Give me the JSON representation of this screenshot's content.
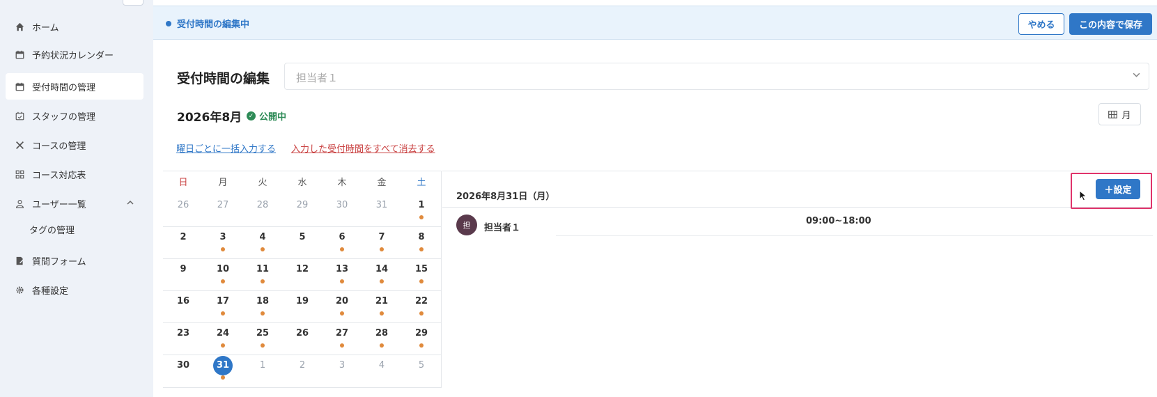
{
  "sidebar": {
    "items": [
      {
        "label": "ホーム",
        "icon": "home-icon"
      },
      {
        "label": "予約状況カレンダー",
        "icon": "calendar-icon"
      },
      {
        "label": "受付時間の管理",
        "icon": "calendar-edit-icon",
        "active": true
      },
      {
        "label": "スタッフの管理",
        "icon": "calendar-check-icon"
      },
      {
        "label": "コースの管理",
        "icon": "tools-icon"
      },
      {
        "label": "コース対応表",
        "icon": "grid-icon"
      },
      {
        "label": "ユーザー一覧",
        "icon": "user-icon",
        "expanded": true
      },
      {
        "label": "質問フォーム",
        "icon": "form-edit-icon"
      },
      {
        "label": "各種設定",
        "icon": "gear-icon"
      }
    ],
    "sub_items": [
      {
        "label": "タグの管理"
      }
    ]
  },
  "banner": {
    "status": "受付時間の編集中",
    "cancel_label": "やめる",
    "save_label": "この内容で保存"
  },
  "editor": {
    "title": "受付時間の編集",
    "staff_select_value": "担当者１",
    "month_title": "2026年8月",
    "publish_status": "公開中",
    "view_label": "月",
    "bulk_link": "曜日ごとに一括入力する",
    "clear_link": "入力した受付時間をすべて消去する"
  },
  "calendar": {
    "weekdays": [
      "日",
      "月",
      "火",
      "水",
      "木",
      "金",
      "土"
    ],
    "weeks": [
      [
        {
          "d": "26",
          "o": true
        },
        {
          "d": "27",
          "o": true
        },
        {
          "d": "28",
          "o": true
        },
        {
          "d": "29",
          "o": true
        },
        {
          "d": "30",
          "o": true
        },
        {
          "d": "31",
          "o": true
        },
        {
          "d": "1",
          "dot": true
        }
      ],
      [
        {
          "d": "2"
        },
        {
          "d": "3",
          "dot": true
        },
        {
          "d": "4",
          "dot": true
        },
        {
          "d": "5"
        },
        {
          "d": "6",
          "dot": true
        },
        {
          "d": "7",
          "dot": true
        },
        {
          "d": "8",
          "dot": true
        }
      ],
      [
        {
          "d": "9"
        },
        {
          "d": "10",
          "dot": true
        },
        {
          "d": "11",
          "dot": true
        },
        {
          "d": "12"
        },
        {
          "d": "13",
          "dot": true
        },
        {
          "d": "14",
          "dot": true
        },
        {
          "d": "15",
          "dot": true
        }
      ],
      [
        {
          "d": "16"
        },
        {
          "d": "17",
          "dot": true
        },
        {
          "d": "18",
          "dot": true
        },
        {
          "d": "19"
        },
        {
          "d": "20",
          "dot": true
        },
        {
          "d": "21",
          "dot": true
        },
        {
          "d": "22",
          "dot": true
        }
      ],
      [
        {
          "d": "23"
        },
        {
          "d": "24",
          "dot": true
        },
        {
          "d": "25",
          "dot": true
        },
        {
          "d": "26"
        },
        {
          "d": "27",
          "dot": true
        },
        {
          "d": "28",
          "dot": true
        },
        {
          "d": "29",
          "dot": true
        }
      ],
      [
        {
          "d": "30"
        },
        {
          "d": "31",
          "dot": true,
          "today": true
        },
        {
          "d": "1",
          "o": true
        },
        {
          "d": "2",
          "o": true
        },
        {
          "d": "3",
          "o": true
        },
        {
          "d": "4",
          "o": true
        },
        {
          "d": "5",
          "o": true
        }
      ]
    ]
  },
  "detail": {
    "date": "2026年8月31日（月）",
    "add_label": "＋設定",
    "staff": {
      "avatar": "担",
      "name": "担当者１",
      "time": "09:00~18:00"
    }
  },
  "colors": {
    "accent": "#2f77c7",
    "danger": "#c94040",
    "success": "#2e8b57",
    "dot": "#e08a3c",
    "highlight": "#e0336b"
  }
}
